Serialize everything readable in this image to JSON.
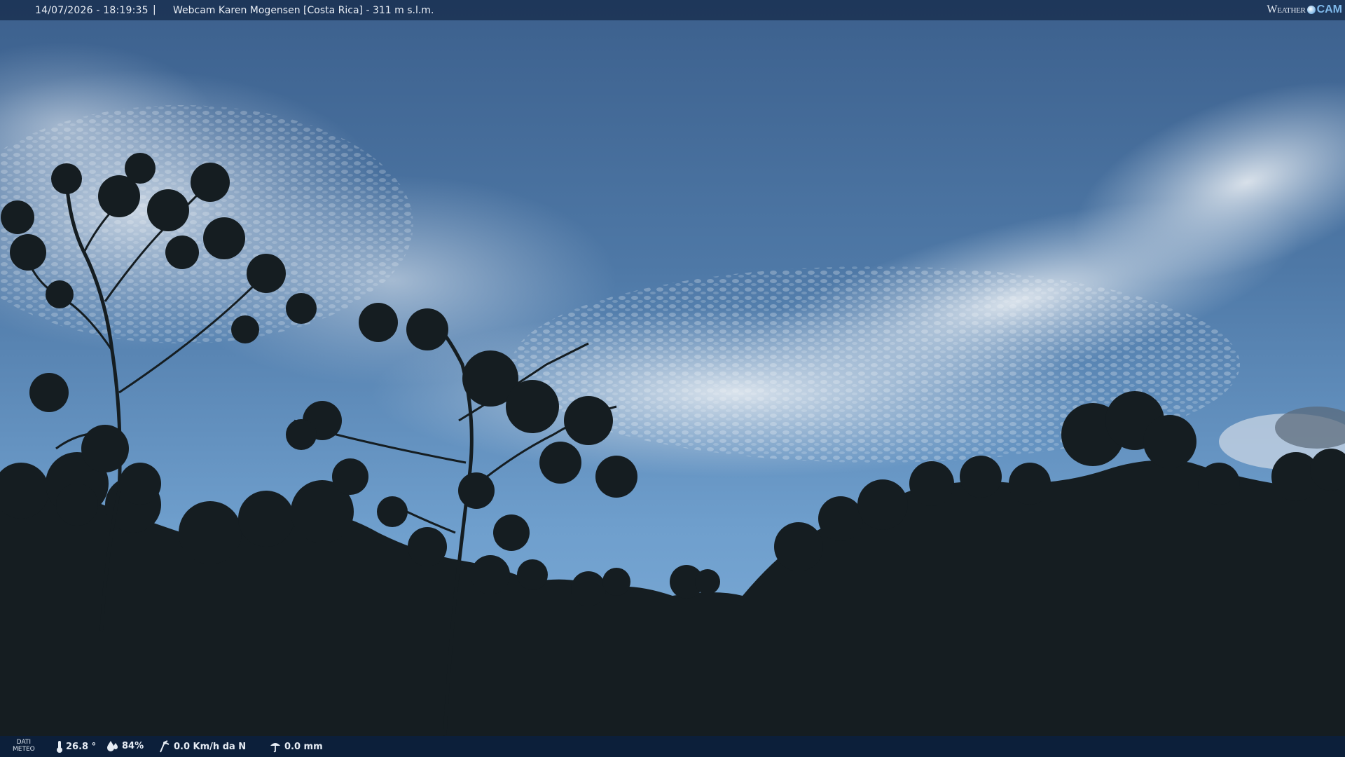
{
  "header": {
    "timestamp": "14/07/2026 - 18:19:35",
    "separator": "|",
    "title": "Webcam Karen Mogensen [Costa Rica] - 311 m s.l.m."
  },
  "logo": {
    "weather": "Weather",
    "cam": "CAM"
  },
  "footer": {
    "label_line1": "DATI",
    "label_line2": "METEO",
    "temperature": "26.8 °",
    "humidity": "84%",
    "wind": "0.0 Km/h da N",
    "rain": "0.0 mm",
    "icons": [
      "thermometer-icon",
      "humidity-icon",
      "wind-icon",
      "rain-icon"
    ]
  },
  "colors": {
    "sky_top": "#3f6593",
    "sky_bottom": "#6a9fd0",
    "foliage": "#141c1f",
    "bar": "#1c3456"
  }
}
